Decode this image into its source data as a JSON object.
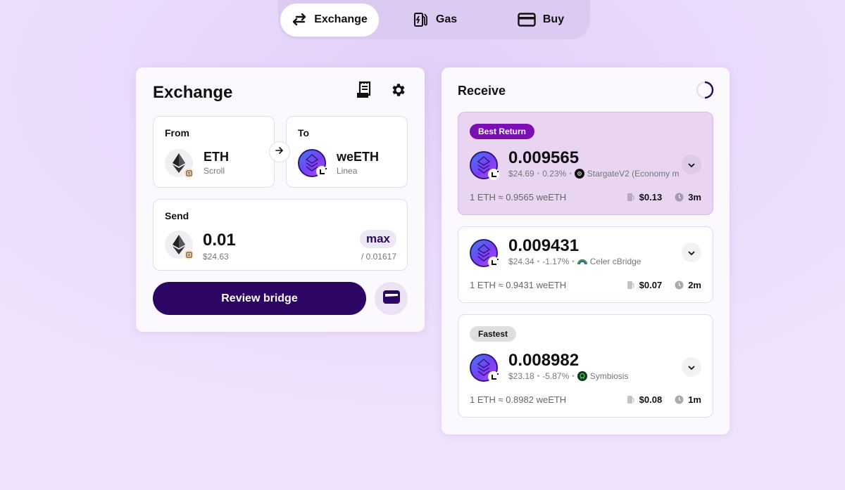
{
  "nav": {
    "tabs": [
      {
        "label": "Exchange",
        "icon": "arrows-exchange-icon",
        "active": true
      },
      {
        "label": "Gas",
        "icon": "gas-pump-icon",
        "active": false
      },
      {
        "label": "Buy",
        "icon": "credit-card-icon",
        "active": false
      }
    ]
  },
  "exchange": {
    "title": "Exchange",
    "history_icon": "receipt-icon",
    "settings_icon": "gear-icon",
    "from": {
      "label": "From",
      "token": "ETH",
      "chain": "Scroll"
    },
    "to": {
      "label": "To",
      "token": "weETH",
      "chain": "Linea"
    },
    "send": {
      "label": "Send",
      "amount": "0.01",
      "usd": "$24.63",
      "max_label": "max",
      "balance": "/ 0.01617"
    },
    "review_button": "Review bridge",
    "wallet_icon": "wallet-icon"
  },
  "receive": {
    "title": "Receive",
    "routes": [
      {
        "badge": "Best Return",
        "amount": "0.009565",
        "usd": "$24.69",
        "change": "0.23%",
        "provider": "StargateV2 (Economy m",
        "rate": "1 ETH ≈ 0.9565 weETH",
        "gas": "$0.13",
        "time": "3m"
      },
      {
        "badge": "",
        "amount": "0.009431",
        "usd": "$24.34",
        "change": "-1.17%",
        "provider": "Celer cBridge",
        "rate": "1 ETH ≈ 0.9431 weETH",
        "gas": "$0.07",
        "time": "2m"
      },
      {
        "badge": "Fastest",
        "amount": "0.008982",
        "usd": "$23.18",
        "change": "-5.87%",
        "provider": "Symbiosis",
        "rate": "1 ETH ≈ 0.8982 weETH",
        "gas": "$0.08",
        "time": "1m"
      }
    ]
  },
  "colors": {
    "primary": "#2d0563",
    "best_badge": "#7a0fb5",
    "best_route_bg": "#e9d5f1"
  }
}
